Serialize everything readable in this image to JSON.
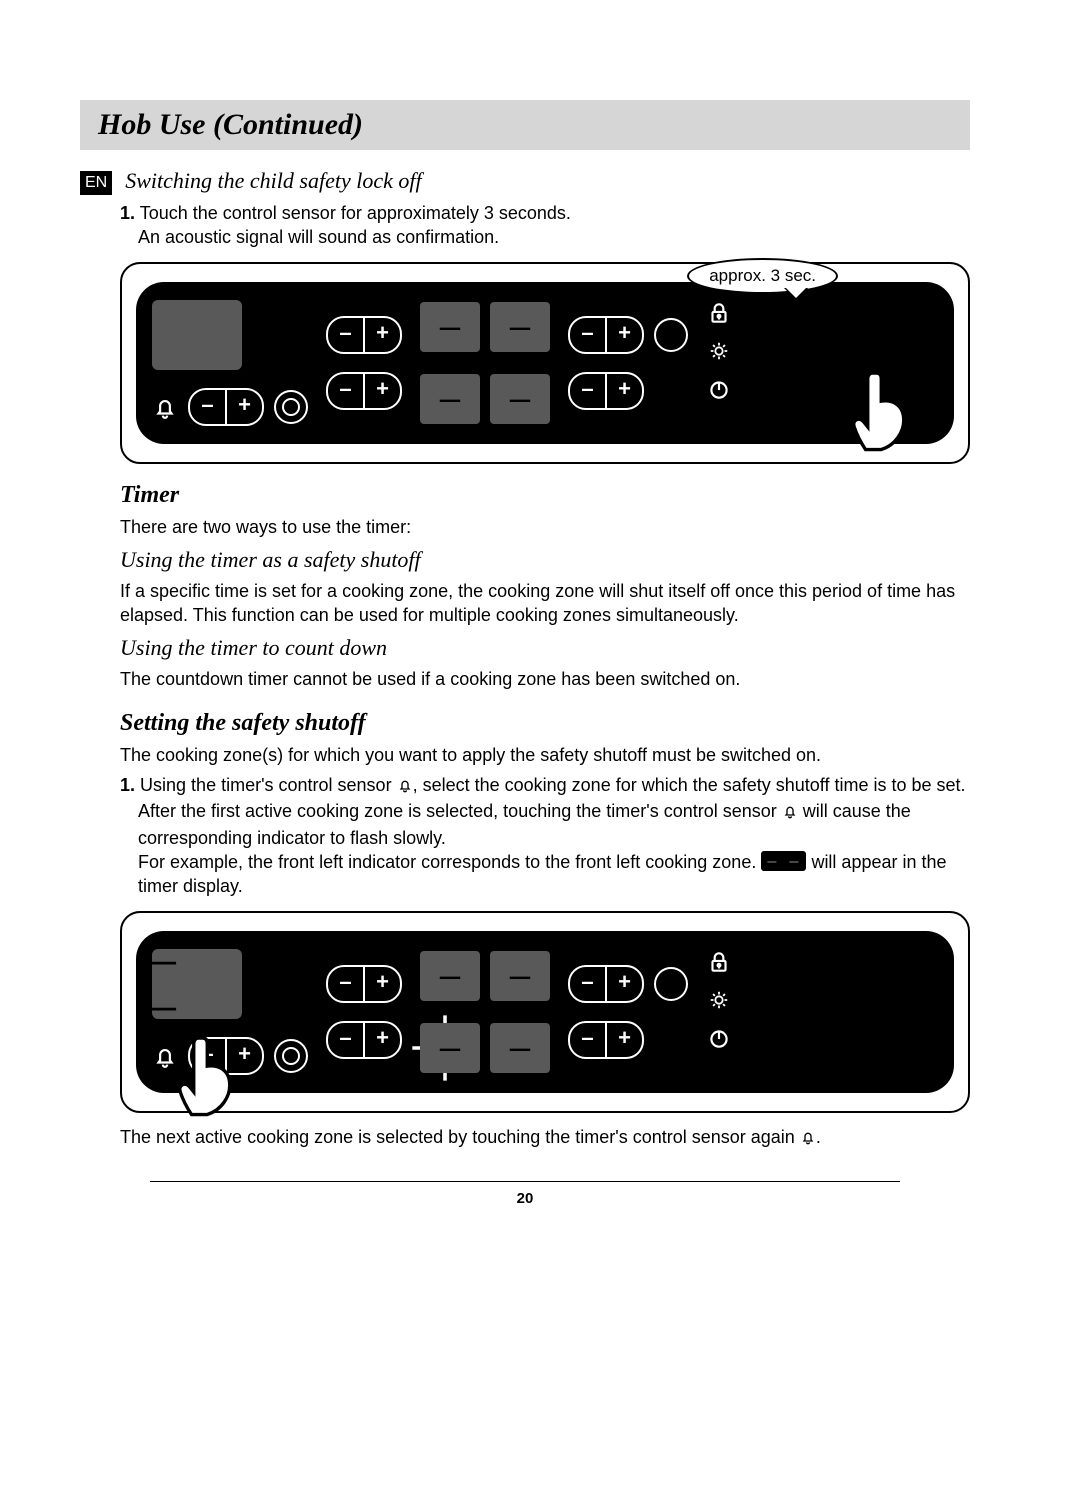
{
  "title": "Hob Use (Continued)",
  "lang_badge": "EN",
  "page_number": "20",
  "section_child_lock": {
    "heading": "Switching the child safety lock off",
    "step1_num": "1.",
    "step1_line1": "Touch the control sensor for approximately 3 seconds.",
    "step1_line2": "An acoustic signal will sound as confirmation.",
    "callout": "approx. 3 sec."
  },
  "section_timer": {
    "heading": "Timer",
    "intro": "There are two ways to use the timer:",
    "sub1_heading": "Using the timer as a safety shutoff",
    "sub1_body": "If a specific time is set for a cooking zone, the cooking zone will shut itself off once this period of time has elapsed. This function can be used for multiple cooking zones simultaneously.",
    "sub2_heading": "Using the timer to count down",
    "sub2_body": "The countdown timer cannot be used if a cooking zone has been switched on."
  },
  "section_shutoff": {
    "heading": "Setting the safety shutoff",
    "intro": "The cooking zone(s) for which you want to apply the safety shutoff must be switched on.",
    "step1_num": "1.",
    "step1_a": "Using the timer's control sensor ",
    "step1_b": ", select the cooking zone for which the safety shutoff time is to be set.",
    "step1_c": "After the first active cooking zone is selected, touching the timer's control sensor ",
    "step1_d": " will cause the corresponding indicator to flash slowly.",
    "step1_e": "For example, the front left indicator corresponds to the front left cooking zone. ",
    "step1_f": " will appear in the timer display.",
    "footer_a": "The next active cooking zone is selected by touching the timer's control sensor again ",
    "footer_b": "."
  },
  "panel": {
    "disp_dash": "– –",
    "disp_single": "–",
    "minus": "–",
    "plus": "+"
  }
}
